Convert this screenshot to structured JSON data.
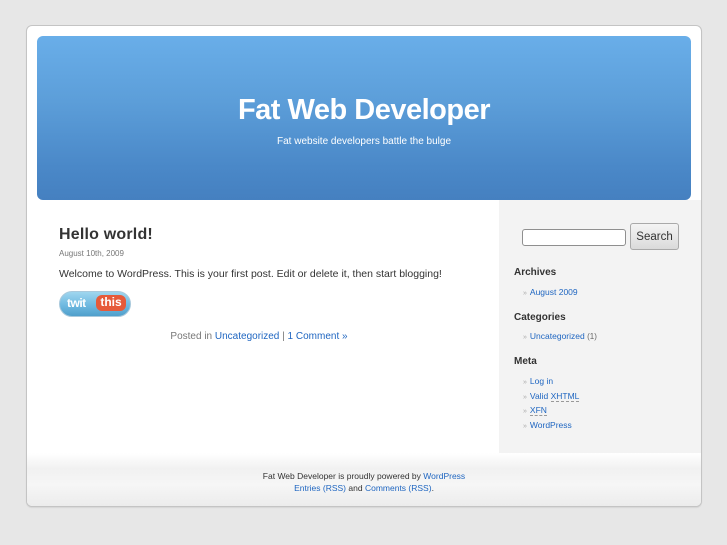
{
  "header": {
    "blog_title": "Fat Web Developer",
    "blog_description": "Fat website developers battle the bulge"
  },
  "post": {
    "title": "Hello world!",
    "date": "August 10th, 2009",
    "body": "Welcome to WordPress. This is your first post. Edit or delete it, then start blogging!",
    "share_button": {
      "left": "twit",
      "right": "this"
    },
    "meta": {
      "posted_in_label": "Posted in",
      "category": "Uncategorized",
      "separator": "|",
      "comments": "1 Comment »"
    }
  },
  "sidebar": {
    "search": {
      "value": "",
      "button_label": "Search"
    },
    "archives": {
      "title": "Archives",
      "items": [
        "August 2009"
      ]
    },
    "categories": {
      "title": "Categories",
      "items": [
        {
          "label": "Uncategorized",
          "count": "(1)"
        }
      ]
    },
    "meta": {
      "title": "Meta",
      "login": "Log in",
      "valid_prefix": "Valid",
      "xhtml": "XHTML",
      "xfn": "XFN",
      "wordpress": "WordPress"
    },
    "bullet": "»"
  },
  "footer": {
    "powered_prefix": "Fat Web Developer is proudly powered by",
    "wordpress_link": "WordPress",
    "entries_link": "Entries (RSS)",
    "and": "and",
    "comments_link": "Comments (RSS)",
    "period": "."
  }
}
